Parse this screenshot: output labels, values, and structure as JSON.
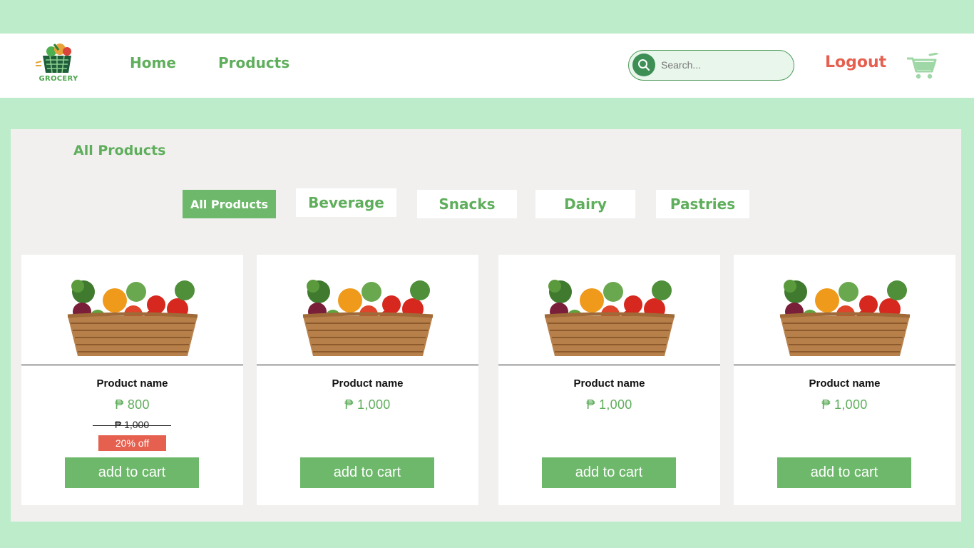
{
  "nav": {
    "logo_text": "GROCERY",
    "home": "Home",
    "products": "Products",
    "search_placeholder": "Search...",
    "logout": "Logout"
  },
  "main": {
    "title": "All Products",
    "categories": [
      {
        "label": "All Products",
        "active": true
      },
      {
        "label": "Beverage",
        "active": false
      },
      {
        "label": "Snacks",
        "active": false
      },
      {
        "label": "Dairy",
        "active": false
      },
      {
        "label": "Pastries",
        "active": false
      }
    ],
    "products": [
      {
        "name": "Product name",
        "price": "₱ 800",
        "old_price": "₱ 1,000",
        "discount": "20% off",
        "button": "add to cart"
      },
      {
        "name": "Product name",
        "price": "₱ 1,000",
        "button": "add to cart"
      },
      {
        "name": "Product name",
        "price": "₱ 1,000",
        "button": "add to cart"
      },
      {
        "name": "Product name",
        "price": "₱ 1,000",
        "button": "add to cart"
      }
    ]
  },
  "colors": {
    "background": "#bdecca",
    "accent_green": "#5fae5c",
    "button_green": "#6db86a",
    "logout_red": "#e5604f",
    "panel": "#f1f0ef"
  }
}
